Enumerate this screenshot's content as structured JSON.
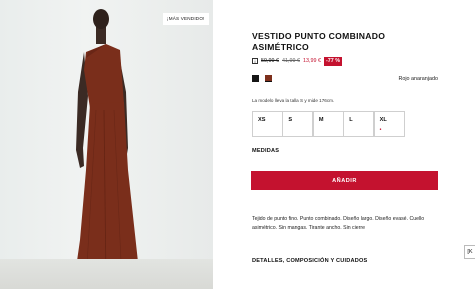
{
  "product_image": {
    "badge": "¡MÁS VENDIDO!"
  },
  "product": {
    "title": "VESTIDO PUNTO COMBINADO ASIMÉTRICO",
    "info_icon": "info-icon",
    "price_original": "59,99 €",
    "price_previous": "41,99 €",
    "price_sale": "13,99 €",
    "discount": "-77 %",
    "colors": [
      {
        "name": "negro",
        "hex": "#151515"
      },
      {
        "name": "rojo-anaranjado",
        "hex": "#7d2f1c"
      }
    ],
    "selected_color": "Rojo anaranjado",
    "model_note": "La modelo lleva la talla S y mide 176cm.",
    "sizes": [
      {
        "label": "XS",
        "mark": ""
      },
      {
        "label": "S",
        "mark": ""
      },
      {
        "label": "M",
        "mark": ""
      },
      {
        "label": "L",
        "mark": ""
      },
      {
        "label": "XL",
        "mark": "•"
      }
    ],
    "measures_label": "MEDIDAS",
    "add_button": "AÑADIR",
    "description": "Tejido de punto fino. Punto combinado. Diseño largo. Diseño evasé. Cuello asimétrico. Sin mangas. Tirante ancho. Sin cierre",
    "details_label": "DETALLES, COMPOSICIÓN Y CUIDADOS"
  },
  "side_tab": {
    "label": "[K"
  },
  "colors": {
    "accent": "#c4122f",
    "dress": "#7a2e1b"
  }
}
